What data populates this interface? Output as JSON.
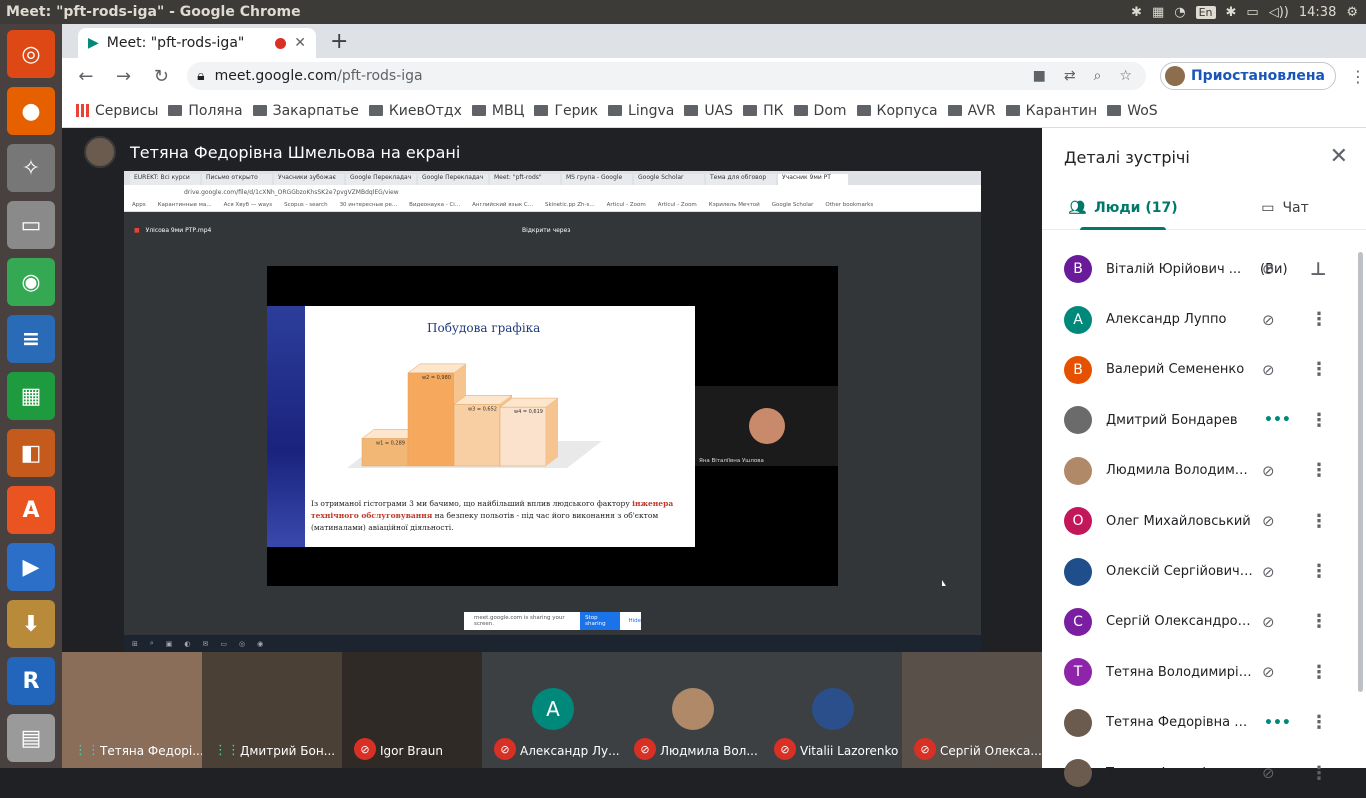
{
  "os": {
    "window_title": "Meet: \"pft-rods-iga\" - Google Chrome",
    "keyboard_layout": "En",
    "clock": "14:38"
  },
  "launcher": {
    "apps": [
      {
        "name": "ubuntu-icon",
        "color": "#dd4814",
        "glyph": "◎"
      },
      {
        "name": "firefox-icon",
        "color": "#e66000",
        "glyph": "●"
      },
      {
        "name": "settings-icon",
        "color": "#777777",
        "glyph": "✧"
      },
      {
        "name": "files-icon",
        "color": "#8a8a8a",
        "glyph": "▭"
      },
      {
        "name": "chrome-icon",
        "color": "#34a853",
        "glyph": "◉"
      },
      {
        "name": "writer-icon",
        "color": "#2a6bb8",
        "glyph": "≡"
      },
      {
        "name": "calc-icon",
        "color": "#1e9b3e",
        "glyph": "▦"
      },
      {
        "name": "impress-icon",
        "color": "#c45a1c",
        "glyph": "◧"
      },
      {
        "name": "software-icon",
        "color": "#e95420",
        "glyph": "A"
      },
      {
        "name": "media-icon",
        "color": "#2c6fc8",
        "glyph": "▶"
      },
      {
        "name": "archive-icon",
        "color": "#b88a3a",
        "glyph": "⬇"
      },
      {
        "name": "r-icon",
        "color": "#2266bb",
        "glyph": "R"
      },
      {
        "name": "printer-icon",
        "color": "#9a9a9a",
        "glyph": "▤"
      }
    ]
  },
  "browser": {
    "tab_title": "Meet: \"pft-rods-iga\"",
    "url_host": "meet.google.com",
    "url_path": "/pft-rods-iga",
    "profile_label": "Приостановлена",
    "bookmarks": [
      "Сервисы",
      "Поляна",
      "Закарпатье",
      "КиевОтдх",
      "МВЦ",
      "Герик",
      "Lingva",
      "UAS",
      "ПК",
      "Dom",
      "Корпуса",
      "AVR",
      "Карантин",
      "WoS"
    ]
  },
  "presentation": {
    "presenter_label": "Тетяна Федорівна Шмельова на екрані",
    "shared_screen": {
      "inner_tabs": [
        "EUREKT: Всі курси",
        "Письмо открыто",
        "Учасники зубожає",
        "Google Перекладач",
        "Google Перекладач",
        "Meet: \"pft-rods\"",
        "MS група - Google",
        "Google Scholar",
        "Тема для обговор",
        "Учасник 9ми РТ"
      ],
      "inner_url": "drive.google.com/file/d/1cXNh_ORGGbzoKhsSK2e7pvgVZMBdqlEG/view",
      "inner_bookmarks": [
        "Apps",
        "Карантинные ма...",
        "Ася Хвуб — ways",
        "Scopus - search",
        "30 интересные ре...",
        "Видеонаука - Ci...",
        "Английский язык С...",
        "Skinetic.pp Zh-s...",
        "Articul - Zoom",
        "Articul - Zoom",
        "Кэрилель Мечтой",
        "Google Scholar",
        "Other bookmarks"
      ],
      "file_name": "Улісова 9ми РТР.mp4",
      "open_with": "Відкрити через",
      "slide_title": "Побудова графіка",
      "slide_caption_plain_1": "Із отриманої гістограми 3 ми бачимо, що найбільший вплив людського фактору ",
      "slide_caption_bold": "інженера технічного обслуговування",
      "slide_caption_plain_2": " на безпеку польотів - під час його виконання з об'єктом (матиналами) авіаційної діяльності.",
      "side_participant": "Яна Віталіївна Ушлова",
      "sharing_text": "meet.google.com is sharing your screen.",
      "stop_label": "Stop sharing",
      "hide_label": "Hide"
    }
  },
  "chart_data": {
    "type": "bar",
    "categories": [
      "1",
      "2",
      "3",
      "4"
    ],
    "values": [
      0.29,
      0.98,
      0.65,
      0.62
    ],
    "data_labels": [
      "w1 = 0,289",
      "w2 = 0,980",
      "w3 = 0,652",
      "w4 = 0,619"
    ],
    "colors": [
      "#f3b775",
      "#f6a95c",
      "#f8cfa2",
      "#fbe2cc"
    ],
    "ylim": [
      0,
      1
    ]
  },
  "filmstrip": [
    {
      "name": "Тетяна Федорі...",
      "state": "talk",
      "bg": "#8a6e5a"
    },
    {
      "name": "Дмитрий Бон...",
      "state": "talk",
      "bg": "#4a4036"
    },
    {
      "name": "Igor Braun",
      "state": "muted",
      "bg": "#2f2a25"
    },
    {
      "name": "Александр Лу...",
      "state": "muted",
      "bg": "#3c4043",
      "initial": "A",
      "avatar_color": "#00897b"
    },
    {
      "name": "Людмила Вол...",
      "state": "muted",
      "bg": "#3c4043",
      "avatar_color": "#b08968"
    },
    {
      "name": "Vitalii Lazorenko",
      "state": "muted",
      "bg": "#3c4043",
      "avatar_color": "#2a4f8a"
    },
    {
      "name": "Сергій Олекса...",
      "state": "muted",
      "bg": "#5a504a"
    }
  ],
  "panel": {
    "title": "Деталі зустрічі",
    "tab_people": "Люди (17)",
    "tab_chat": "Чат",
    "you_label": "(Ви)",
    "people": [
      {
        "name": "Віталій Юрійович ...",
        "initial": "В",
        "color": "#6a1b9a",
        "state": "muted",
        "you": true
      },
      {
        "name": "Александр Луппо",
        "initial": "А",
        "color": "#00897b",
        "state": "muted"
      },
      {
        "name": "Валерий Семененко",
        "initial": "В",
        "color": "#e65100",
        "state": "muted"
      },
      {
        "name": "Дмитрий Бондарев",
        "initial": "",
        "color": "#6b6b6b",
        "state": "talk"
      },
      {
        "name": "Людмила Володимирі...",
        "initial": "",
        "color": "#b08968",
        "state": "muted"
      },
      {
        "name": "Олег Михайловський",
        "initial": "О",
        "color": "#c2185b",
        "state": "muted"
      },
      {
        "name": "Олексій Сергійович П...",
        "initial": "",
        "color": "#1f4e8a",
        "state": "muted"
      },
      {
        "name": "Сергій Олександрови...",
        "initial": "С",
        "color": "#7b1fa2",
        "state": "muted"
      },
      {
        "name": "Тетяна Володимирівна...",
        "initial": "Т",
        "color": "#8e24aa",
        "state": "muted"
      },
      {
        "name": "Тетяна Федорівна Шме...",
        "initial": "",
        "color": "#6b5a4e",
        "state": "talk"
      },
      {
        "name": "Тетяна Федорівна Шме...",
        "initial": "",
        "color": "#6b5a4e",
        "state": "muted"
      }
    ]
  }
}
